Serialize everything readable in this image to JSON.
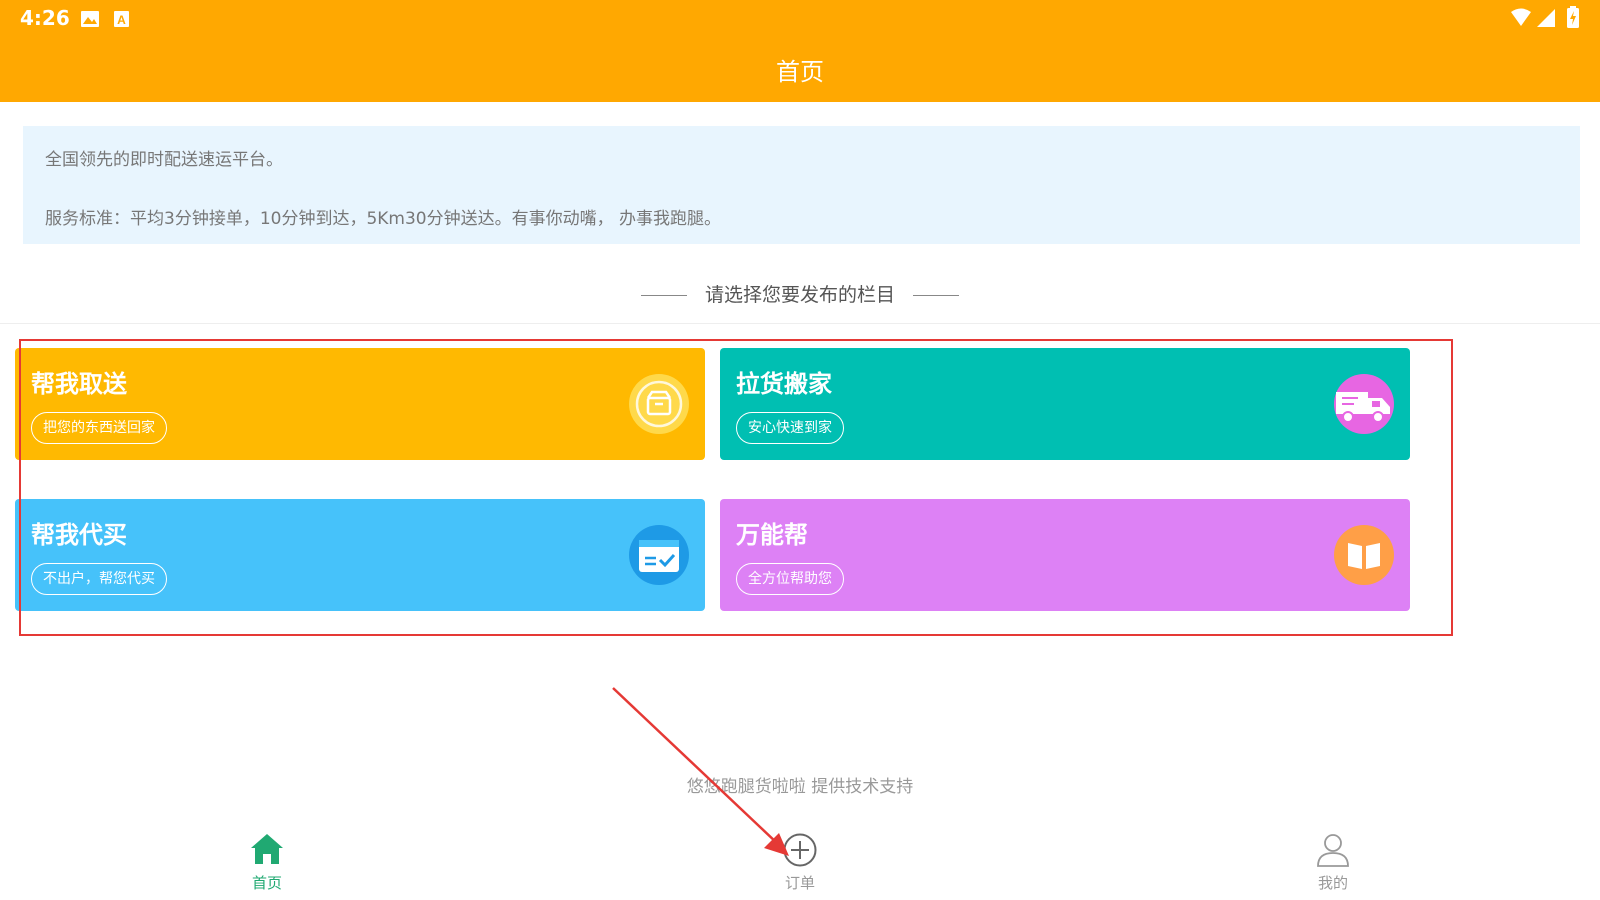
{
  "status_bar": {
    "time": "4:26"
  },
  "header": {
    "title": "首页"
  },
  "notice": {
    "line1": "全国领先的即时配送速运平台。",
    "line2": "服务标准：平均3分钟接单，10分钟到达，5Km30分钟送达。有事你动嘴， 办事我跑腿。"
  },
  "section_title": "请选择您要发布的栏目",
  "cards": [
    {
      "title": "帮我取送",
      "subtitle": "把您的东西送回家",
      "color": "#FFB901",
      "icon_color": "#FFD94A",
      "icon": "package-icon"
    },
    {
      "title": "拉货搬家",
      "subtitle": "安心快速到家",
      "color": "#00BFB2",
      "icon_color": "#E766E2",
      "icon": "truck-icon"
    },
    {
      "title": "帮我代买",
      "subtitle": "不出户，帮您代买",
      "color": "#46C2FA",
      "icon_color": "#1E9AE6",
      "icon": "card-check-icon"
    },
    {
      "title": "万能帮",
      "subtitle": "全方位帮助您",
      "color": "#DD81F5",
      "icon_color": "#FF9F47",
      "icon": "book-icon"
    }
  ],
  "footer_text": "悠悠跑腿货啦啦 提供技术支持",
  "nav": [
    {
      "label": "首页",
      "icon": "home-icon",
      "active": true
    },
    {
      "label": "订单",
      "icon": "plus-circle-icon",
      "active": false
    },
    {
      "label": "我的",
      "icon": "person-icon",
      "active": false
    }
  ],
  "colors": {
    "header": "#FFA801",
    "accent_active": "#20A972",
    "annotation": "#E53935"
  }
}
